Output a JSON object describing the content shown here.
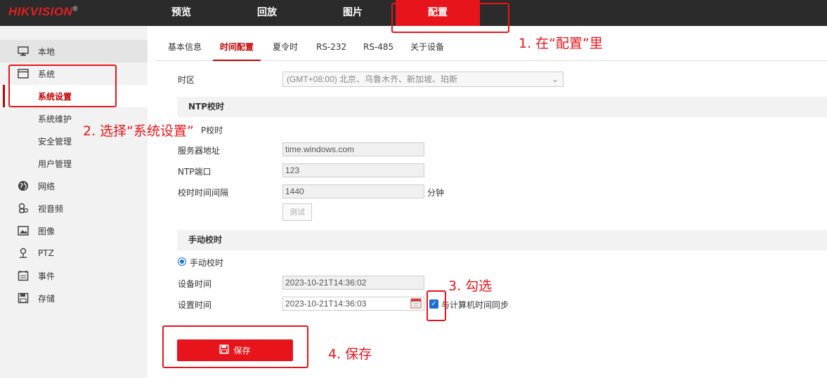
{
  "brand": {
    "logo": "HIKVISION",
    "reg": "®"
  },
  "topnav": [
    "预览",
    "回放",
    "图片",
    "配置"
  ],
  "sidebar": {
    "items": [
      {
        "label": "本地",
        "icon": "monitor-icon"
      },
      {
        "label": "系统",
        "icon": "system-window-icon"
      },
      {
        "label": "系统设置",
        "icon": ""
      },
      {
        "label": "系统维护",
        "icon": ""
      },
      {
        "label": "安全管理",
        "icon": ""
      },
      {
        "label": "用户管理",
        "icon": ""
      },
      {
        "label": "网络",
        "icon": "globe-icon"
      },
      {
        "label": "视音频",
        "icon": "microphone-icon"
      },
      {
        "label": "图像",
        "icon": "image-icon"
      },
      {
        "label": "PTZ",
        "icon": "ptz-icon"
      },
      {
        "label": "事件",
        "icon": "calendar-icon"
      },
      {
        "label": "存储",
        "icon": "save-disk-icon"
      }
    ]
  },
  "tabs": [
    "基本信息",
    "时间配置",
    "夏令时",
    "RS-232",
    "RS-485",
    "关于设备"
  ],
  "form": {
    "timezone_label": "时区",
    "timezone_value": "(GMT+08:00) 北京、乌鲁木齐、新加坡、珀斯",
    "ntp_section": "NTP校时",
    "ntp_radio_label": "P校时",
    "server_label": "服务器地址",
    "server_value": "time.windows.com",
    "port_label": "NTP端口",
    "port_value": "123",
    "interval_label": "校时时间间隔",
    "interval_value": "1440",
    "interval_unit": "分钟",
    "test_label": "测试",
    "manual_section": "手动校时",
    "manual_radio_label": "手动校时",
    "device_time_label": "设备时间",
    "device_time_value": "2023-10-21T14:36:02",
    "set_time_label": "设置时间",
    "set_time_value": "2023-10-21T14:36:03",
    "sync_label": "与计算机时间同步",
    "sync_checked": true,
    "save_label": "保存"
  },
  "annotations": {
    "step1": "1. 在“配置”里",
    "step2": "2. 选择“系统设置”",
    "step3": "3. 勾选",
    "step4": "4. 保存"
  },
  "colors": {
    "accent": "#e8141c",
    "topbar": "#2b2b2b",
    "sidebar": "#f2f2f2",
    "check": "#1a6fd6"
  }
}
